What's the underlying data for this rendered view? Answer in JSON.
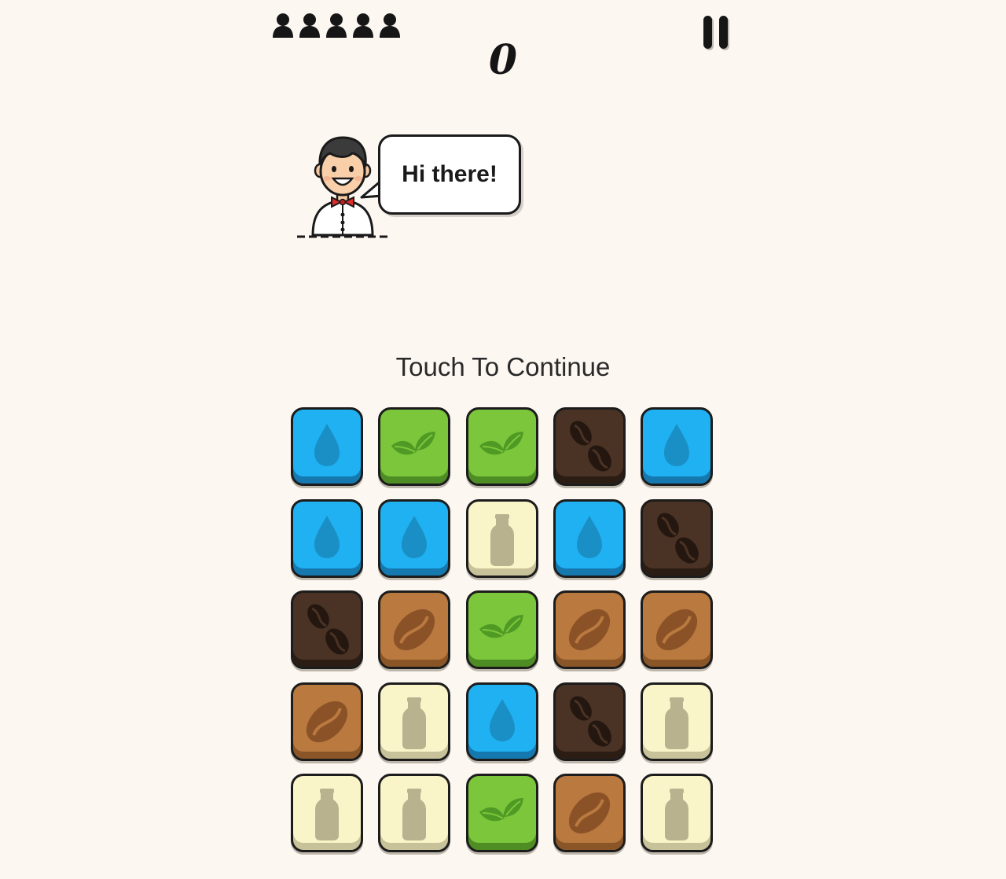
{
  "hud": {
    "customers_remaining": 5,
    "score": "0",
    "person_icon": "person-silhouette-icon",
    "pause_icon": "pause-icon"
  },
  "dialog": {
    "speaker": "waiter",
    "text": "Hi there!"
  },
  "prompt": "Touch To Continue",
  "tile_types": {
    "water": {
      "icon": "water-drop-icon",
      "color": "#1fb1f2",
      "shade": "#1a8fc6",
      "edge": "#1579b0"
    },
    "leaf": {
      "icon": "leaf-icon",
      "color": "#7cc63b",
      "shade": "#4f9a24",
      "edge": "#4e8d24"
    },
    "dark_coffee": {
      "icon": "coffee-beans-icon",
      "color": "#4a3224",
      "shade": "#231710",
      "edge": "#2c1d14"
    },
    "light_coffee": {
      "icon": "coffee-bean-icon",
      "color": "#b9793f",
      "shade": "#8a5226",
      "edge": "#8a5627"
    },
    "milk": {
      "icon": "milk-bottle-icon",
      "color": "#faf5c8",
      "shade": "#b8b28e",
      "edge": "#c8c29b"
    }
  },
  "board": {
    "rows": 5,
    "cols": 5,
    "tiles": [
      [
        "water",
        "leaf",
        "leaf",
        "dark_coffee",
        "water"
      ],
      [
        "water",
        "water",
        "milk",
        "water",
        "dark_coffee"
      ],
      [
        "dark_coffee",
        "light_coffee",
        "leaf",
        "light_coffee",
        "light_coffee"
      ],
      [
        "light_coffee",
        "milk",
        "water",
        "dark_coffee",
        "milk"
      ],
      [
        "milk",
        "milk",
        "leaf",
        "light_coffee",
        "milk"
      ]
    ]
  }
}
